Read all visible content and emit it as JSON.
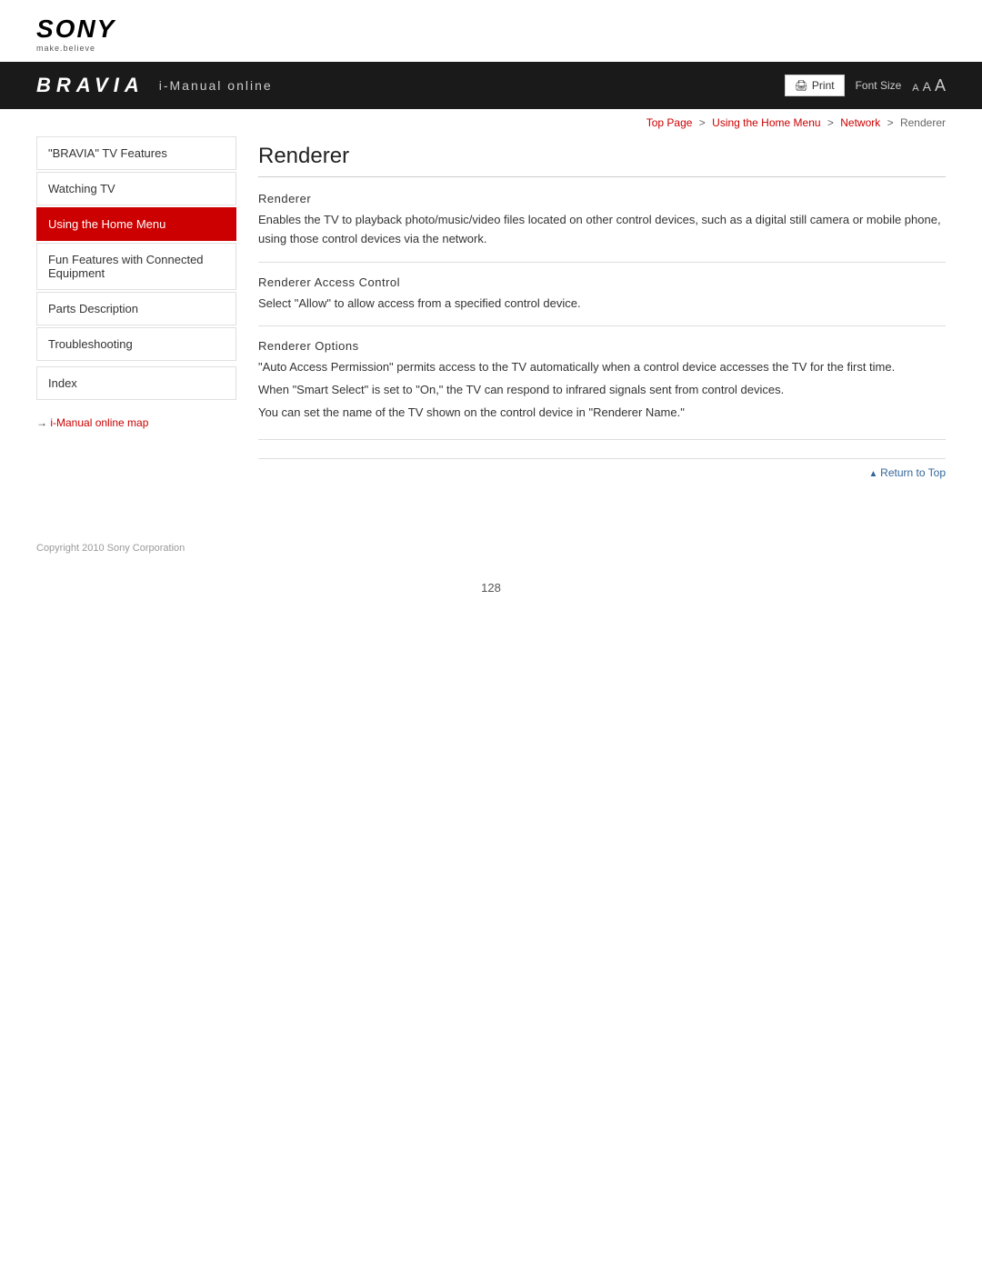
{
  "brand": {
    "sony": "SONY",
    "tagline": "make.believe",
    "bravia": "BRAVIA",
    "subtitle": "i-Manual online"
  },
  "toolbar": {
    "print_label": "Print",
    "font_size_label": "Font Size",
    "font_small": "A",
    "font_mid": "A",
    "font_large": "A"
  },
  "breadcrumb": {
    "top_page": "Top Page",
    "sep1": ">",
    "home_menu": "Using the Home Menu",
    "sep2": ">",
    "network": "Network",
    "sep3": ">",
    "current": "Renderer"
  },
  "sidebar": {
    "items": [
      {
        "id": "bravia-tv-features",
        "label": "\"BRAVIA\" TV Features",
        "active": false
      },
      {
        "id": "watching-tv",
        "label": "Watching TV",
        "active": false
      },
      {
        "id": "using-home-menu",
        "label": "Using the Home Menu",
        "active": true
      },
      {
        "id": "fun-features",
        "label": "Fun Features with Connected Equipment",
        "active": false
      },
      {
        "id": "parts-description",
        "label": "Parts Description",
        "active": false
      },
      {
        "id": "troubleshooting",
        "label": "Troubleshooting",
        "active": false
      },
      {
        "id": "index",
        "label": "Index",
        "active": false,
        "is_index": true
      }
    ],
    "map_link": "i-Manual online map"
  },
  "content": {
    "page_title": "Renderer",
    "sections": [
      {
        "id": "renderer",
        "header": "Renderer",
        "body": "Enables the TV to playback photo/music/video files located on other control devices, such as a digital still camera or mobile phone, using those control devices via the network."
      },
      {
        "id": "renderer-access-control",
        "header": "Renderer Access Control",
        "body": "Select \"Allow\" to allow access from a specified control device."
      },
      {
        "id": "renderer-options",
        "header": "Renderer Options",
        "body_lines": [
          "\"Auto Access Permission\" permits access to the TV automatically when a control device accesses the TV for the first time.",
          "When \"Smart Select\" is set to \"On,\" the TV can respond to infrared signals sent from control devices.",
          "You can set the name of the TV shown on the control device in \"Renderer Name.\""
        ]
      }
    ],
    "return_to_top": "Return to Top"
  },
  "footer": {
    "copyright": "Copyright 2010 Sony Corporation",
    "page_number": "128"
  }
}
